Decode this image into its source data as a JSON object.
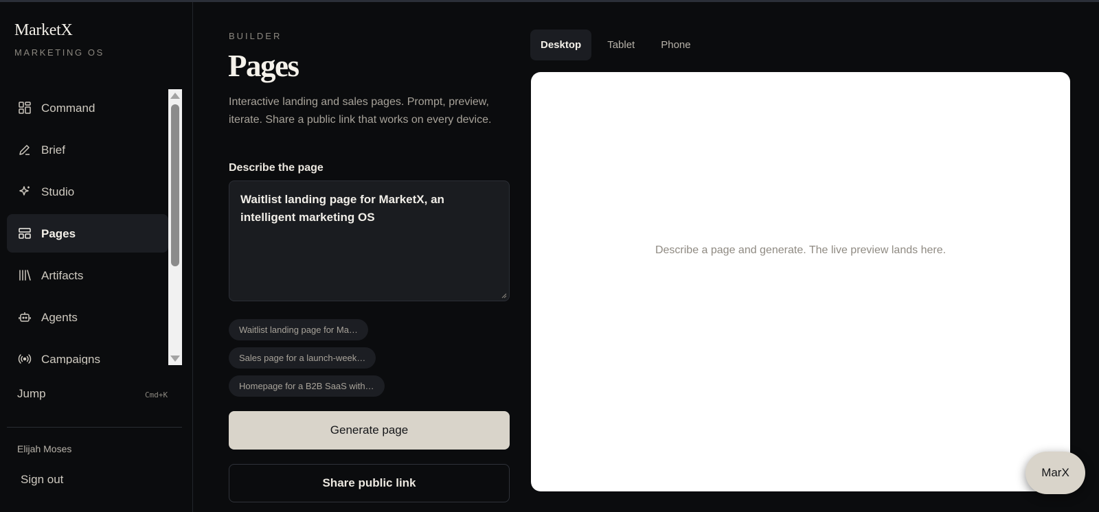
{
  "brand": {
    "name": "MarketX",
    "subtitle": "MARKETING OS"
  },
  "sidebar": {
    "items": [
      {
        "label": "Command",
        "icon": "grid-icon",
        "active": false
      },
      {
        "label": "Brief",
        "icon": "pen-icon",
        "active": false
      },
      {
        "label": "Studio",
        "icon": "sparkle-icon",
        "active": false
      },
      {
        "label": "Pages",
        "icon": "layout-icon",
        "active": true
      },
      {
        "label": "Artifacts",
        "icon": "library-icon",
        "active": false
      },
      {
        "label": "Agents",
        "icon": "robot-icon",
        "active": false
      },
      {
        "label": "Campaigns",
        "icon": "broadcast-icon",
        "active": false
      }
    ],
    "jump_label": "Jump",
    "jump_shortcut": "Cmd+K",
    "user_name": "Elijah Moses",
    "sign_out": "Sign out"
  },
  "builder": {
    "eyebrow": "BUILDER",
    "title": "Pages",
    "description": "Interactive landing and sales pages. Prompt, preview, iterate. Share a public link that works on every device.",
    "field_label": "Describe the page",
    "prompt_value": "Waitlist landing page for MarketX, an intelligent marketing OS",
    "suggestions": [
      "Waitlist landing page for Ma…",
      "Sales page for a launch-week…",
      "Homepage for a B2B SaaS with…"
    ],
    "generate_label": "Generate page",
    "share_label": "Share public link"
  },
  "preview": {
    "tabs": [
      {
        "label": "Desktop",
        "active": true
      },
      {
        "label": "Tablet",
        "active": false
      },
      {
        "label": "Phone",
        "active": false
      }
    ],
    "empty_text": "Describe a page and generate. The live preview lands here."
  },
  "assistant": {
    "label": "MarX"
  }
}
